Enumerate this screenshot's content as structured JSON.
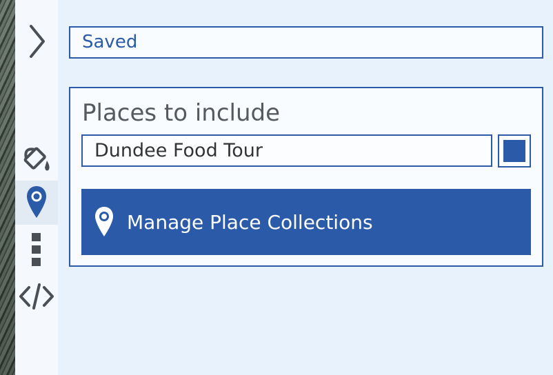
{
  "sidebar": {
    "items": [
      {
        "name": "expand",
        "icon": "chevron-right-icon"
      },
      {
        "name": "style",
        "icon": "paint-bucket-icon"
      },
      {
        "name": "places",
        "icon": "map-pin-icon",
        "active": true
      },
      {
        "name": "more",
        "icon": "vertical-dots-icon"
      },
      {
        "name": "embed",
        "icon": "code-icon"
      }
    ]
  },
  "status": {
    "text": "Saved"
  },
  "places": {
    "title": "Places to include",
    "collection": "Dundee Food Tour",
    "swatch_color": "#2b5aa8",
    "manage_label": "Manage Place Collections"
  },
  "colors": {
    "accent": "#2b5aa8",
    "panel_bg": "#e8f2fd",
    "icon_gray": "#4a4f55"
  }
}
